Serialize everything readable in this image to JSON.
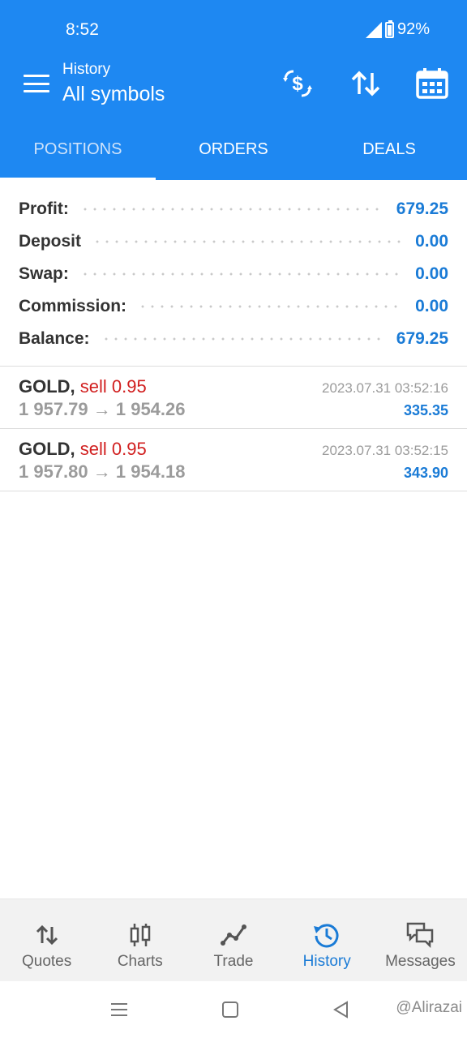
{
  "status": {
    "time": "8:52",
    "battery": "92%"
  },
  "appbar": {
    "subtitle": "History",
    "title": "All symbols"
  },
  "tabs": [
    {
      "label": "POSITIONS",
      "active": true
    },
    {
      "label": "ORDERS",
      "active": false
    },
    {
      "label": "DEALS",
      "active": false
    }
  ],
  "summary": [
    {
      "label": "Profit:",
      "value": "679.25"
    },
    {
      "label": "Deposit",
      "value": "0.00"
    },
    {
      "label": "Swap:",
      "value": "0.00"
    },
    {
      "label": "Commission:",
      "value": "0.00"
    },
    {
      "label": "Balance:",
      "value": "679.25"
    }
  ],
  "deals": [
    {
      "symbol": "GOLD,",
      "side": "sell 0.95",
      "prices": "1 957.79 → 1 954.26",
      "time": "2023.07.31 03:52:16",
      "profit": "335.35"
    },
    {
      "symbol": "GOLD,",
      "side": "sell 0.95",
      "prices": "1 957.80 → 1 954.18",
      "time": "2023.07.31 03:52:15",
      "profit": "343.90"
    }
  ],
  "nav": [
    {
      "label": "Quotes",
      "icon": "quotes-icon"
    },
    {
      "label": "Charts",
      "icon": "charts-icon"
    },
    {
      "label": "Trade",
      "icon": "trade-icon"
    },
    {
      "label": "History",
      "icon": "history-icon",
      "active": true
    },
    {
      "label": "Messages",
      "icon": "messages-icon"
    }
  ],
  "watermark": "@Alirazai",
  "colors": {
    "primary": "#1e88f2",
    "profit": "#1a7bd6",
    "sell": "#d11f1f"
  }
}
